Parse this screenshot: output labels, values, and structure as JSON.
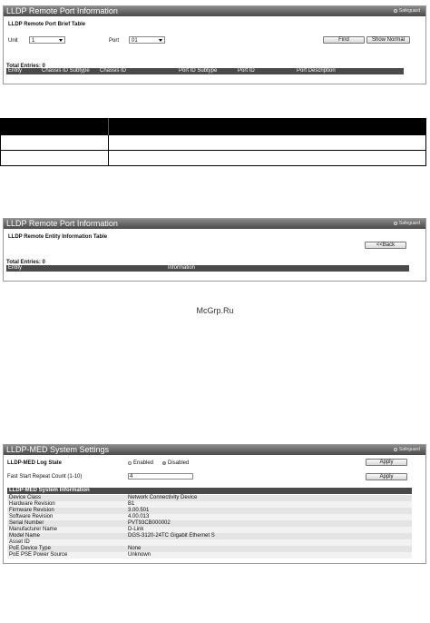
{
  "watermark": "McGrp.Ru",
  "safeguard_label": "Safeguard",
  "panel1": {
    "title": "LLDP Remote Port Information",
    "subtitle": "LLDP Remote Port Brief Table",
    "unit_label": "Unit",
    "unit_value": "1",
    "port_label": "Port",
    "port_value": "01",
    "find_button": "Find",
    "show_normal_button": "Show Normal",
    "total_entries": "Total Entries: 0",
    "columns": [
      "Entity",
      "Chassis ID Subtype",
      "Chassis ID",
      "Port ID Subtype",
      "Port ID",
      "Port Description"
    ]
  },
  "panel2": {
    "title": "LLDP Remote Port Information",
    "subtitle": "LLDP Remote Entity Information Table",
    "back_button": "<<Back",
    "total_entries": "Total Entries: 0",
    "columns": [
      "Entity",
      "Information"
    ]
  },
  "panel3": {
    "title": "LLDP-MED System Settings",
    "log_state_label": "LLDP-MED Log State",
    "enabled_label": "Enabled",
    "disabled_label": "Disabled",
    "log_state_selected": "Disabled",
    "apply_button": "Apply",
    "fast_start_label": "Fast Start Repeat Count (1-10)",
    "fast_start_value": "4",
    "apply_button2": "Apply",
    "info_title": "LLDP-MED System Information",
    "info_rows": [
      {
        "label": "Device Class",
        "value": "Network Connectivity Device"
      },
      {
        "label": "Hardware Revision",
        "value": "B1"
      },
      {
        "label": "Firmware Revision",
        "value": "3.00.501"
      },
      {
        "label": "Software Revision",
        "value": "4.00.013"
      },
      {
        "label": "Serial Number",
        "value": "PVT93CB000002"
      },
      {
        "label": "Manufacturer Name",
        "value": "D-Link"
      },
      {
        "label": "Model Name",
        "value": "DGS-3120-24TC Gigabit Ethernet S"
      },
      {
        "label": "Asset ID",
        "value": ""
      },
      {
        "label": "PoE Device Type",
        "value": "None"
      },
      {
        "label": "PoE PSE Power Source",
        "value": "Unknown"
      }
    ]
  }
}
